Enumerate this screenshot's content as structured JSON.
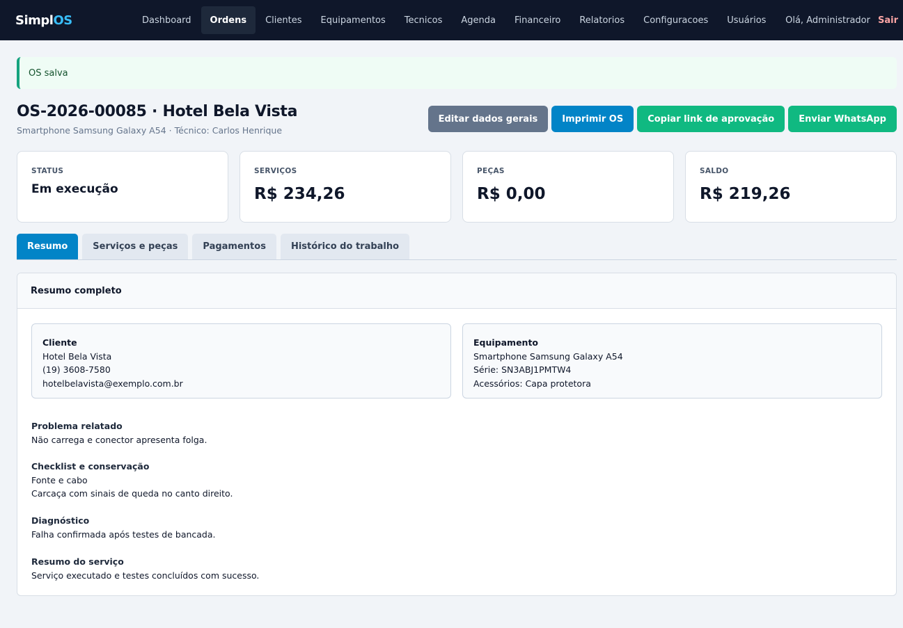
{
  "brand": {
    "prefix": "Simpl",
    "suffix": "OS"
  },
  "nav": [
    {
      "label": "Dashboard",
      "active": false
    },
    {
      "label": "Ordens",
      "active": true
    },
    {
      "label": "Clientes",
      "active": false
    },
    {
      "label": "Equipamentos",
      "active": false
    },
    {
      "label": "Tecnicos",
      "active": false
    },
    {
      "label": "Agenda",
      "active": false
    },
    {
      "label": "Financeiro",
      "active": false
    },
    {
      "label": "Relatorios",
      "active": false
    },
    {
      "label": "Configuracoes",
      "active": false
    },
    {
      "label": "Usuários",
      "active": false
    }
  ],
  "user": {
    "greeting": "Olá, Administrador",
    "logout": "Sair"
  },
  "alert": {
    "message": "OS salva"
  },
  "header": {
    "title": "OS-2026-00085 · Hotel Bela Vista",
    "subtitle": "Smartphone Samsung Galaxy A54 · Técnico: Carlos Henrique"
  },
  "actions": {
    "edit": "Editar dados gerais",
    "print": "Imprimir OS",
    "copy_link": "Copiar link de aprovação",
    "whatsapp": "Enviar WhatsApp"
  },
  "summary_cards": {
    "status": {
      "label": "STATUS",
      "value": "Em execução"
    },
    "services": {
      "label": "SERVIÇOS",
      "value": "R$ 234,26"
    },
    "parts": {
      "label": "PEÇAS",
      "value": "R$ 0,00"
    },
    "balance": {
      "label": "SALDO",
      "value": "R$ 219,26"
    }
  },
  "tabs": [
    {
      "label": "Resumo",
      "active": true
    },
    {
      "label": "Serviços e peças",
      "active": false
    },
    {
      "label": "Pagamentos",
      "active": false
    },
    {
      "label": "Histórico do trabalho",
      "active": false
    }
  ],
  "panel": {
    "title": "Resumo completo",
    "client": {
      "heading": "Cliente",
      "name": "Hotel Bela Vista",
      "phone": "(19) 3608-7580",
      "email": "hotelbelavista@exemplo.com.br"
    },
    "equipment": {
      "heading": "Equipamento",
      "model": "Smartphone Samsung Galaxy A54",
      "serial": "Série: SN3ABJ1PMTW4",
      "accessories": "Acessórios: Capa protetora"
    },
    "problem": {
      "heading": "Problema relatado",
      "text": "Não carrega e conector apresenta folga."
    },
    "checklist": {
      "heading": "Checklist e conservação",
      "line1": "Fonte e cabo",
      "line2": "Carcaça com sinais de queda no canto direito."
    },
    "diagnosis": {
      "heading": "Diagnóstico",
      "text": "Falha confirmada após testes de bancada."
    },
    "service_summary": {
      "heading": "Resumo do serviço",
      "text": "Serviço executado e testes concluídos com sucesso."
    }
  }
}
